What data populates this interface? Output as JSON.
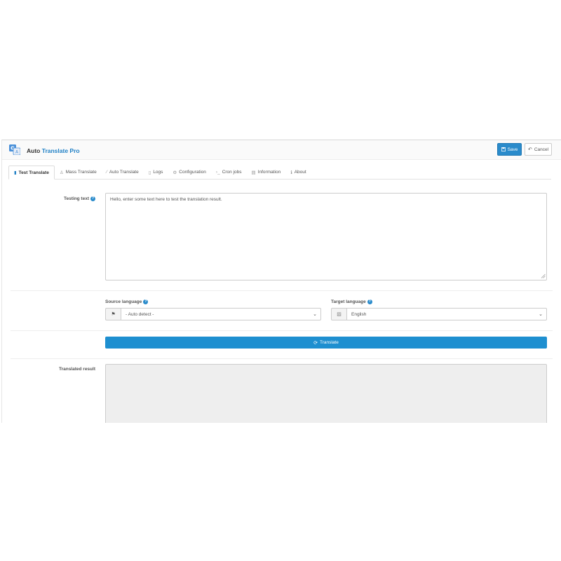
{
  "app": {
    "title_prefix": "Auto",
    "title_accent": "Translate Pro"
  },
  "toolbar": {
    "save_label": "Save",
    "cancel_label": "Cancel"
  },
  "tabs": [
    {
      "label": "Test Translate",
      "icon": "translate-icon",
      "active": true
    },
    {
      "label": "Mass Translate",
      "icon": "person-icon",
      "active": false
    },
    {
      "label": "Auto Translate",
      "icon": "magic-wand-icon",
      "active": false
    },
    {
      "label": "Logs",
      "icon": "file-icon",
      "active": false
    },
    {
      "label": "Configuration",
      "icon": "gear-icon",
      "active": false
    },
    {
      "label": "Cron jobs",
      "icon": "terminal-icon",
      "active": false
    },
    {
      "label": "Information",
      "icon": "book-icon",
      "active": false
    },
    {
      "label": "About",
      "icon": "info-icon",
      "active": false
    }
  ],
  "form": {
    "testing_text_label": "Testing text",
    "testing_text_value": "Hello, enter some text here to test the translation result.",
    "source_language_label": "Source language",
    "source_language_value": "- Auto detect -",
    "target_language_label": "Target language",
    "target_language_value": "English",
    "translate_button": "Translate",
    "translated_result_label": "Translated result"
  },
  "colors": {
    "accent": "#1e7fc5",
    "primary_button": "#2a8bcb",
    "result_bg": "#eeeeee"
  }
}
